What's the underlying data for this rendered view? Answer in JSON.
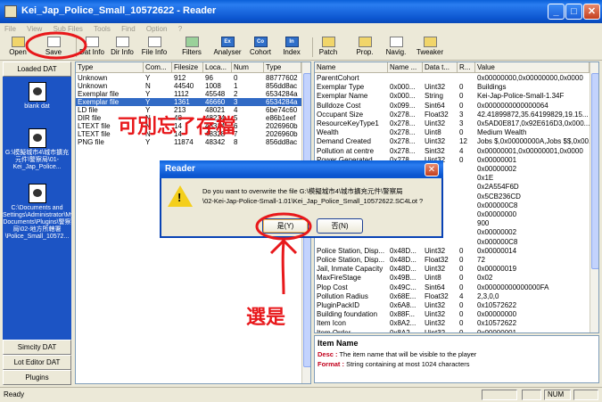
{
  "window": {
    "title": "Kei_Jap_Police_Small_10572622 - Reader"
  },
  "menu": [
    "File",
    "View",
    "Sub Files",
    "Tools",
    "Find",
    "Option",
    "?"
  ],
  "toolbar": [
    {
      "label": "Open",
      "icon": "open-folder-icon"
    },
    {
      "label": "Save",
      "icon": "save-disk-icon"
    },
    {
      "label": "Dat Info",
      "icon": "dat-info-icon"
    },
    {
      "label": "Dir Info",
      "icon": "dir-info-icon"
    },
    {
      "label": "File Info",
      "icon": "file-info-icon"
    },
    {
      "label": "Filters",
      "icon": "filters-icon"
    },
    {
      "label": "Analyser",
      "icon": "analyser-icon",
      "glyph": "Ex"
    },
    {
      "label": "Cohort",
      "icon": "cohort-icon",
      "glyph": "Co"
    },
    {
      "label": "Index",
      "icon": "index-icon",
      "glyph": "In"
    },
    {
      "label": "Patch",
      "icon": "patch-icon"
    },
    {
      "label": "Prop.",
      "icon": "properties-icon"
    },
    {
      "label": "Navig.",
      "icon": "navigator-icon"
    },
    {
      "label": "Tweaker",
      "icon": "tweaker-icon"
    }
  ],
  "left_panel": {
    "header": "Loaded DAT",
    "items": [
      {
        "label": "blank dat"
      },
      {
        "label": "G:\\模擬城市4\\城市擴充元件\\警察局\\01-Kei_Jap_Police..."
      },
      {
        "label": "C:\\Documents and Settings\\Administrator\\My Documents\\Plugins\\警察局\\02-地方所轄署\\Police_Small_10572..."
      }
    ],
    "footer_tabs": [
      "Simcity DAT",
      "Lot Editor DAT",
      "Plugins"
    ]
  },
  "file_grid": {
    "columns": [
      "Type",
      "Com...",
      "Filesize",
      "Loca...",
      "Num",
      "Type"
    ],
    "rows": [
      [
        "Unknown",
        "Y",
        "912",
        "96",
        "0",
        "88777602"
      ],
      [
        "Unknown",
        "N",
        "44540",
        "1008",
        "1",
        "856dd8ac"
      ],
      [
        "Exemplar file",
        "Y",
        "1112",
        "45548",
        "2",
        "6534284a"
      ],
      [
        "Exemplar file",
        "Y",
        "1361",
        "46660",
        "3",
        "6534284a"
      ],
      [
        "LD file",
        "Y",
        "213",
        "48021",
        "4",
        "6be74c60"
      ],
      [
        "DIR file",
        "N",
        "48",
        "48234",
        "5",
        "e86b1eef"
      ],
      [
        "LTEXT file",
        "N",
        "14",
        "48314",
        "6",
        "2026960b"
      ],
      [
        "LTEXT file",
        "N",
        "14",
        "48328",
        "7",
        "2026960b"
      ],
      [
        "PNG file",
        "Y",
        "11874",
        "48342",
        "8",
        "856dd8ac"
      ]
    ],
    "selected_row": 3
  },
  "prop_grid": {
    "columns": [
      "Name",
      "Name ...",
      "Data t...",
      "R...",
      "Value"
    ],
    "rows": [
      [
        "ParentCohort",
        "",
        "",
        "",
        "0x00000000,0x00000000,0x0000"
      ],
      [
        "Exemplar Type",
        "0x000...",
        "Uint32",
        "0",
        "Buildings"
      ],
      [
        "Exemplar Name",
        "0x000...",
        "String",
        "0",
        "Kei-Jap-Police-Small-1.34F"
      ],
      [
        "Bulldoze Cost",
        "0x099...",
        "Sint64",
        "0",
        "0x0000000000000064"
      ],
      [
        "Occupant Size",
        "0x278...",
        "Float32",
        "3",
        "42.41899872,35.64199829,19.15..."
      ],
      [
        "ResourceKeyType1",
        "0x278...",
        "Uint32",
        "3",
        "0x5AD0E817,0x92E616D3,0x000..."
      ],
      [
        "Wealth",
        "0x278...",
        "Uint8",
        "0",
        "Medium Wealth"
      ],
      [
        "Demand Created",
        "0x278...",
        "Uint32",
        "12",
        "Jobs $,0x00000000A,Jobs $$,0x00..."
      ],
      [
        "Pollution at centre",
        "0x278...",
        "Sint32",
        "4",
        "0x00000001,0x00000001,0x0000"
      ],
      [
        "Power Generated",
        "0x278...",
        "Uint32",
        "0",
        "0x00000001"
      ],
      [
        "",
        "",
        "",
        "",
        "0x00000002"
      ],
      [
        "",
        "",
        "",
        "",
        "0x1E"
      ],
      [
        "",
        "",
        "",
        "",
        "0x2A554F6D"
      ],
      [
        "",
        "",
        "",
        "",
        "0x5CB236CD"
      ],
      [
        "",
        "",
        "",
        "",
        "0x000000C8"
      ],
      [
        "",
        "",
        "",
        "",
        "0x00000000"
      ],
      [
        "",
        "",
        "",
        "",
        "900"
      ],
      [
        "",
        "",
        "",
        "",
        "0x00000002"
      ],
      [
        "",
        "",
        "",
        "",
        "0x000000C8"
      ],
      [
        "Police Station, Disp...",
        "0x48D...",
        "Uint32",
        "0",
        "0x00000014"
      ],
      [
        "Police Station, Disp...",
        "0x48D...",
        "Float32",
        "0",
        "72"
      ],
      [
        "Jail, Inmate Capacity",
        "0x48D...",
        "Uint32",
        "0",
        "0x00000019"
      ],
      [
        "MaxFireStage",
        "0x49B...",
        "Uint8",
        "0",
        "0x02"
      ],
      [
        "Plop Cost",
        "0x49C...",
        "Sint64",
        "0",
        "0x00000000000000FA"
      ],
      [
        "Pollution Radius",
        "0x68E...",
        "Float32",
        "4",
        "2,3,0,0"
      ],
      [
        "PluginPackID",
        "0x6A8...",
        "Uint32",
        "0",
        "0x10572622"
      ],
      [
        "Building foundation",
        "0x88F...",
        "Uint32",
        "0",
        "0x00000000"
      ],
      [
        "Item Icon",
        "0x8A2...",
        "Uint32",
        "0",
        "0x10572622"
      ],
      [
        "Item Order",
        "0x8A2...",
        "Uint32",
        "0",
        "0x00000001"
      ]
    ]
  },
  "description": {
    "title": "Item Name",
    "desc_key": "Desc :",
    "desc_text": "The item name that will be visible to the player",
    "format_key": "Format :",
    "format_text": "String containing at most 1024 characters"
  },
  "status": {
    "ready": "Ready",
    "num": "NUM"
  },
  "dialog": {
    "title": "Reader",
    "message_line1": "Do you want to overwrite the file G:\\模擬城市4\\城市擴充元件\\警察局",
    "message_line2": "\\02-Kei-Jap-Police-Small-1.01\\Kei_Jap_Police_Small_10572622.SC4Lot ?",
    "yes_label": "是(Y)",
    "no_label": "否(N)"
  },
  "annotations": {
    "top_note": "可別忘了存檔",
    "bottom_note": "選是"
  },
  "colors": {
    "accent_blue": "#1c54c4",
    "annotation_red": "#e8181b",
    "selected_row": "#316ac5"
  }
}
